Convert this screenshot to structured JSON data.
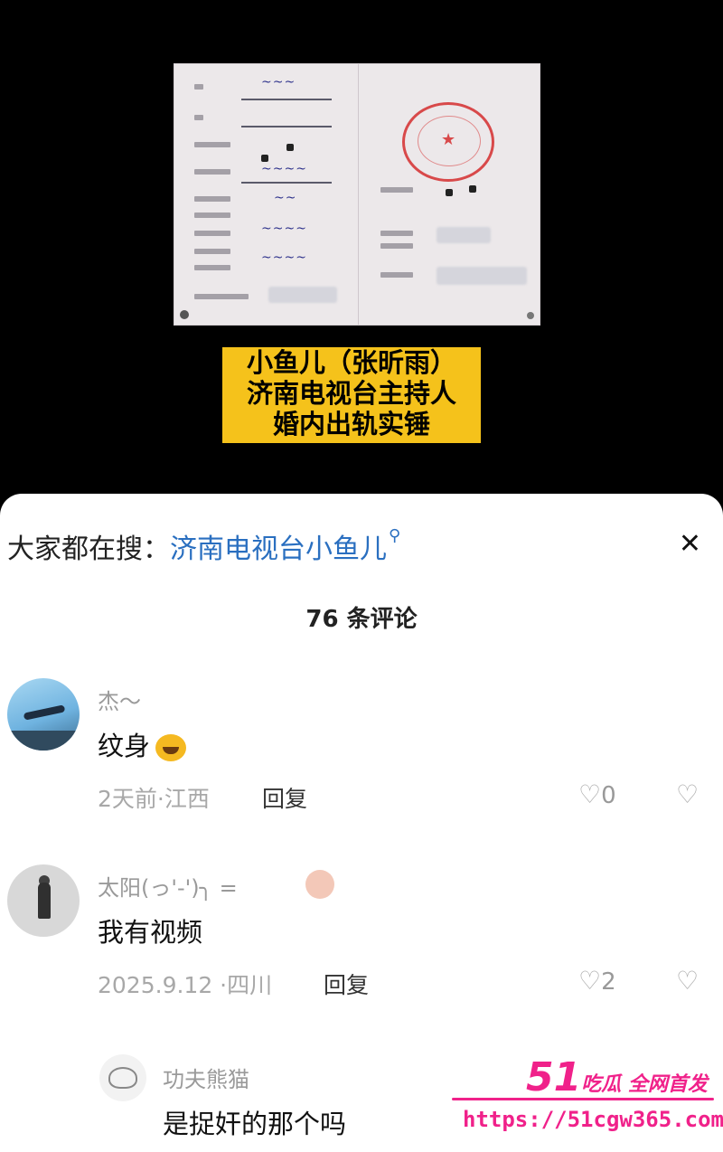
{
  "video": {
    "caption_lines": [
      "小鱼儿（张昕雨）",
      "济南电视台主持人",
      "婚内出轨实锤"
    ]
  },
  "search": {
    "prefix": "大家都在搜：",
    "term": "济南电视台小鱼儿",
    "icon": "search-icon"
  },
  "close_icon": "close-icon",
  "comment_count": "76 条评论",
  "comments": [
    {
      "name": "杰～",
      "text": "纹身",
      "emoji": "laughing-crying-emoji",
      "meta": "2天前·江西",
      "reply": "回复",
      "likes": "0"
    },
    {
      "name": "太阳(っ'-')╮ =",
      "text": "我有视频",
      "meta": "2025.9.12 ·四川",
      "reply": "回复",
      "likes": "2"
    },
    {
      "name": "功夫熊猫",
      "text": "是捉奸的那个吗"
    }
  ],
  "watermark": {
    "brand_num": "51",
    "brand_text": "吃瓜 全网首发",
    "url": "https://51cgw365.com"
  },
  "colors": {
    "link": "#2a6fc0",
    "caption_bg": "#f5c21b",
    "watermark": "#f0218a"
  }
}
